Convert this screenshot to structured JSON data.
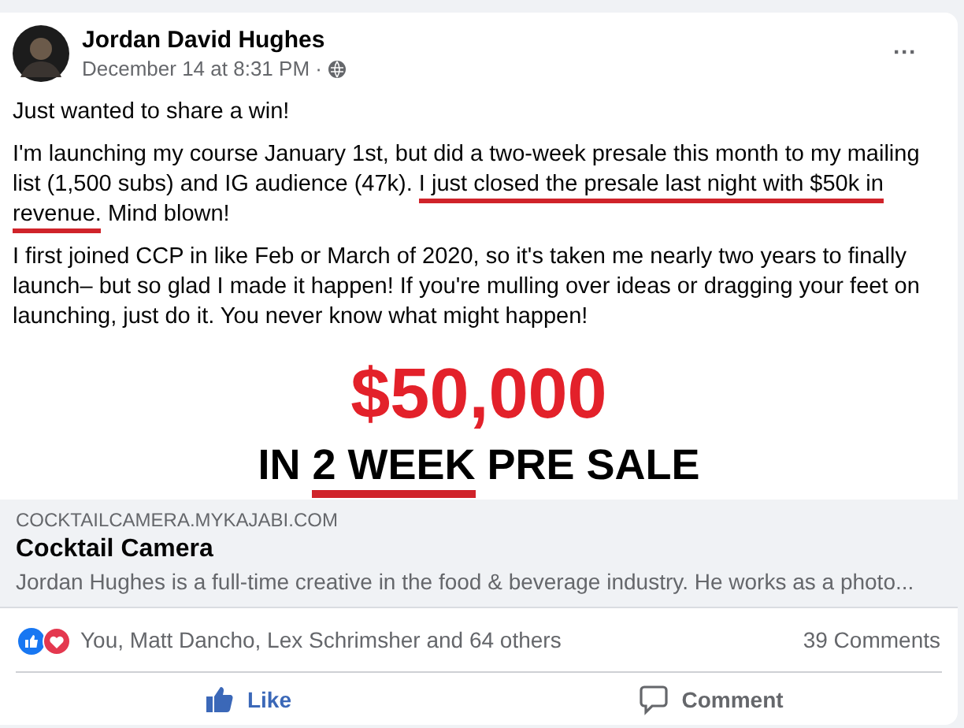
{
  "post": {
    "author": "Jordan David Hughes",
    "time": "December 14 at 8:31 PM ·",
    "more": "···",
    "paragraphs": [
      [
        {
          "text": "Just wanted to share a win!",
          "underlined": false
        }
      ],
      [
        {
          "text": "I'm launching my course January 1st, but did a two-week presale this month to my mailing list (1,500 subs) and IG audience (47k). ",
          "underlined": false
        },
        {
          "text": "I just closed the presale last night with $50k in revenue.",
          "underlined": true
        },
        {
          "text": " Mind blown!",
          "underlined": false
        }
      ],
      [
        {
          "text": "I first joined CCP in like Feb or March of 2020, so it's taken me nearly two years to finally launch– but so glad I made it happen! If you're mulling over ideas or dragging your feet on launching, just do it. You never know what might happen!",
          "underlined": false
        }
      ]
    ]
  },
  "overlay": {
    "headline": "$50,000",
    "subline": [
      {
        "text": "IN ",
        "underlined": false
      },
      {
        "text": "2 WEEK",
        "underlined": true
      },
      {
        "text": " PRE SALE",
        "underlined": false
      }
    ]
  },
  "link_preview": {
    "domain": "COCKTAILCAMERA.MYKAJABI.COM",
    "title": "Cocktail Camera",
    "description": "Jordan Hughes is a full-time creative in the food & beverage industry. He works as a photo..."
  },
  "reactions": {
    "names": "You, Matt Dancho, Lex Schrimsher and 64 others",
    "comments": "39 Comments"
  },
  "actions": [
    {
      "kind": "like",
      "label": "Like",
      "selected": true
    },
    {
      "kind": "comment",
      "label": "Comment",
      "selected": false
    }
  ]
}
